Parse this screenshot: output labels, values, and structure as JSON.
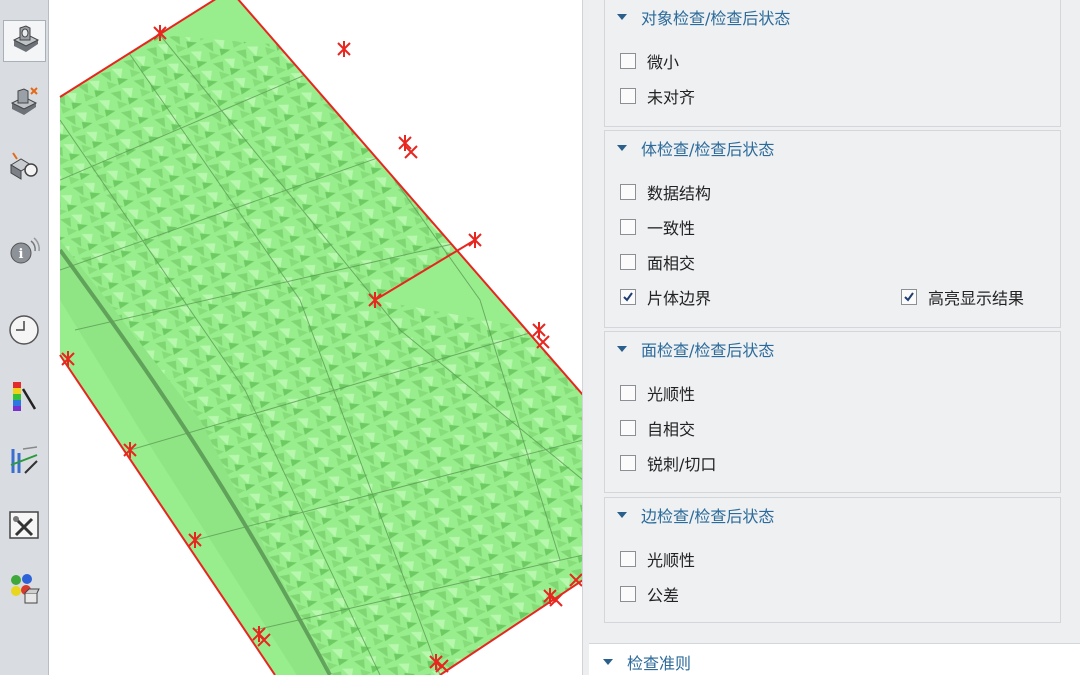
{
  "toolbar": {
    "tools": [
      {
        "icon": "part-icon",
        "active": true
      },
      {
        "icon": "examine-geometry-icon",
        "active": false
      },
      {
        "icon": "inspect-body-icon",
        "active": false
      },
      {
        "icon": "info-icon",
        "active": false
      },
      {
        "icon": "clock-icon",
        "active": false
      },
      {
        "icon": "color-analysis-icon",
        "active": false
      },
      {
        "icon": "dimension-analysis-icon",
        "active": false
      },
      {
        "icon": "tools-icon",
        "active": false
      },
      {
        "icon": "palette-icon",
        "active": false
      }
    ]
  },
  "colors": {
    "surface": "#98ee8c",
    "boundary": "#e8251f",
    "section_title": "#2b6a9a"
  },
  "panel": {
    "object_check": {
      "title": "对象检查/检查后状态",
      "options": [
        {
          "label": "微小",
          "checked": false
        },
        {
          "label": "未对齐",
          "checked": false
        }
      ]
    },
    "body_check": {
      "title": "体检查/检查后状态",
      "options": [
        {
          "label": "数据结构",
          "checked": false
        },
        {
          "label": "一致性",
          "checked": false
        },
        {
          "label": "面相交",
          "checked": false
        },
        {
          "label": "片体边界",
          "checked": true
        }
      ],
      "highlight_label": "高亮显示结果",
      "highlight_checked": true
    },
    "face_check": {
      "title": "面检查/检查后状态",
      "options": [
        {
          "label": "光顺性",
          "checked": false
        },
        {
          "label": "自相交",
          "checked": false
        },
        {
          "label": "锐刺/切口",
          "checked": false
        }
      ]
    },
    "edge_check": {
      "title": "边检查/检查后状态",
      "options": [
        {
          "label": "光顺性",
          "checked": false
        },
        {
          "label": "公差",
          "checked": false
        }
      ]
    },
    "criteria": {
      "title": "检查准则"
    }
  }
}
